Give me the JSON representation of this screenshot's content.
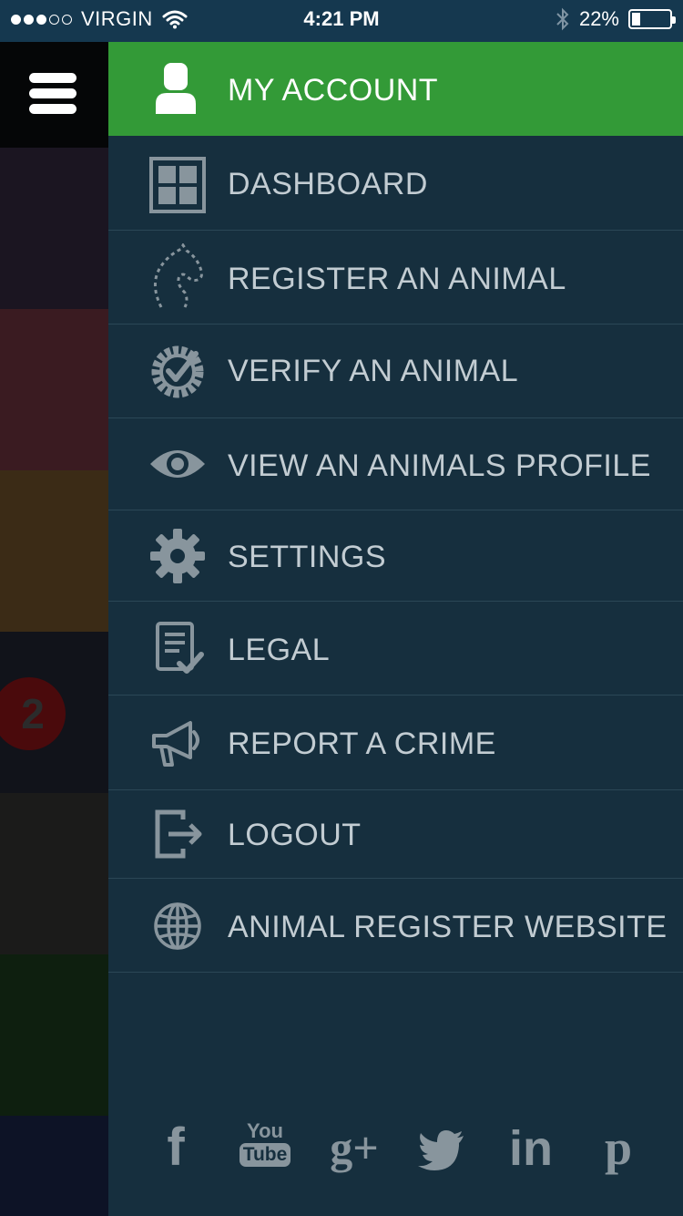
{
  "status_bar": {
    "carrier": "VIRGIN",
    "signal_bars": 3,
    "signal_total": 5,
    "time": "4:21 PM",
    "battery_text": "22%",
    "battery_level": 0.22
  },
  "underlying": {
    "badge_count": "2",
    "strip_colors": [
      "#1b1521",
      "#3a1b21",
      "#3b2b16",
      "#11131a",
      "#1b1b1a",
      "#0e1f0f",
      "#0d1326"
    ]
  },
  "menu": {
    "account": {
      "label": "MY ACCOUNT",
      "icon": "user-icon",
      "color": "#339a37"
    },
    "items": [
      {
        "label": "DASHBOARD",
        "icon": "dashboard-icon"
      },
      {
        "label": "REGISTER AN ANIMAL",
        "icon": "horse-head-icon"
      },
      {
        "label": "VERIFY AN ANIMAL",
        "icon": "verified-badge-icon"
      },
      {
        "label": "VIEW AN ANIMALS PROFILE",
        "icon": "eye-icon"
      },
      {
        "label": "SETTINGS",
        "icon": "gear-icon"
      },
      {
        "label": "LEGAL",
        "icon": "document-check-icon"
      },
      {
        "label": "REPORT A CRIME",
        "icon": "megaphone-icon"
      },
      {
        "label": "LOGOUT",
        "icon": "logout-icon"
      },
      {
        "label": "ANIMAL REGISTER WEBSITE",
        "icon": "globe-icon"
      }
    ]
  },
  "social": {
    "facebook": "f",
    "youtube_top": "You",
    "youtube_bottom": "Tube",
    "google_plus": "g+",
    "linkedin": "in",
    "pinterest": "p"
  },
  "colors": {
    "panel_bg": "#162f3e",
    "status_bg": "#15384f",
    "menu_text": "#c2ccd2",
    "icon_color": "#88959d",
    "divider": "#2b4756"
  }
}
